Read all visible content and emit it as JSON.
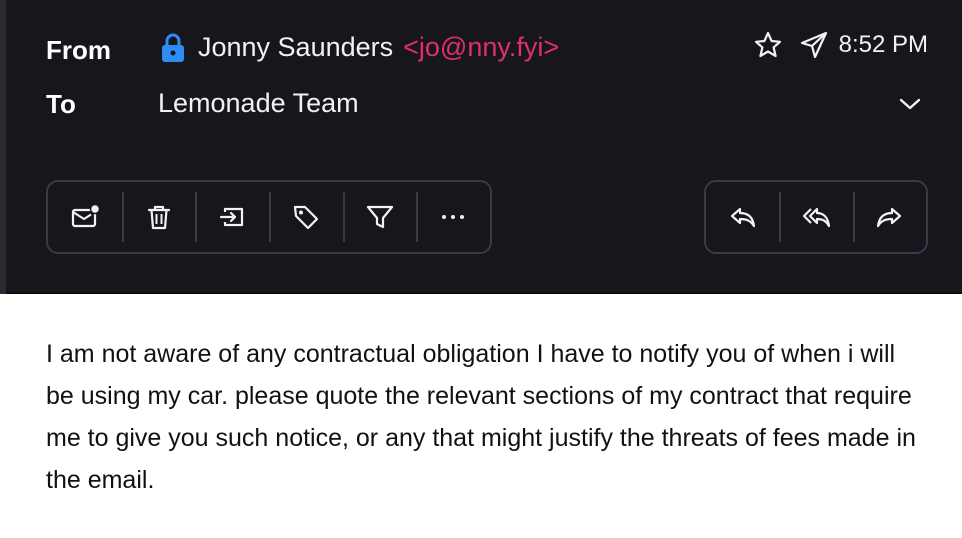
{
  "header": {
    "from_label": "From",
    "to_label": "To",
    "sender_name": "Jonny Saunders",
    "sender_email": "<jo@nny.fyi>",
    "recipient": "Lemonade Team",
    "time": "8:52 PM",
    "icons": {
      "lock": "lock-icon",
      "star": "star-icon",
      "sent": "send-icon",
      "expand": "chevron-down-icon"
    }
  },
  "toolbar": {
    "left_actions": [
      "mark-unread",
      "delete",
      "move-to-folder",
      "tag",
      "filter",
      "more"
    ],
    "right_actions": [
      "reply",
      "reply-all",
      "forward"
    ]
  },
  "message": {
    "body": "I am not aware of any contractual obligation I have to notify you of when i will be using my car. please quote the relevant sections of my contract that require me to give you such notice, or any that might justify the threats of fees made in the email."
  },
  "colors": {
    "header_bg": "#17161d",
    "email_accent": "#e0306a",
    "lock_blue": "#2f8cf5",
    "toolbar_border": "#3b3a44"
  }
}
